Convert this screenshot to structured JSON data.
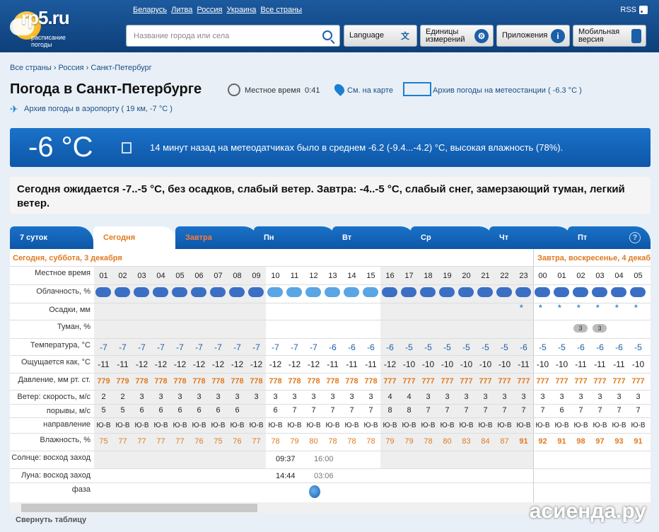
{
  "header": {
    "brand": "rp5.ru",
    "sub1": "расписание",
    "sub2": "погоды",
    "links": [
      "Беларусь",
      "Литва",
      "Россия",
      "Украина",
      "Все страны"
    ],
    "rss": "RSS",
    "search_placeholder": "Название города или села",
    "language": "Language",
    "units1": "Единицы",
    "units2": "измерений",
    "apps": "Приложения",
    "mobile1": "Мобильная",
    "mobile2": "версия"
  },
  "breadcrumb": [
    "Все страны",
    "Россия",
    "Санкт-Петербург"
  ],
  "title": "Погода в Санкт-Петербурге",
  "local_time_label": "Местное время",
  "local_time": "0:41",
  "map_link": "См. на карте",
  "archive_link": "Архив погоды на метеостанции ( -6.3 °C )",
  "airport_link": "Архив погоды в аэропорту ( 19 км, -7 °C )",
  "current": {
    "temp": "-6 °C",
    "text": "14 минут назад на метеодатчиках было в среднем -6.2 (-9.4...-4.2) °C, высокая влажность (78%)."
  },
  "summary": "Сегодня ожидается -7..-5 °C, без осадков, слабый ветер. Завтра: -4..-5 °C, слабый снег, замерзающий туман, легкий ветер.",
  "tabs": [
    "7 суток",
    "Сегодня",
    "Завтра",
    "Пн",
    "Вт",
    "Ср",
    "Чт",
    "Пт"
  ],
  "help": "?",
  "day1": "Сегодня, суббота, 3 декабря",
  "day2": "Завтра, воскресенье, 4 декабря",
  "rows": {
    "hours": "Местное время",
    "cloud": "Облачность, %",
    "precip": "Осадки, мм",
    "fog": "Туман, %",
    "temp": "Температура, °C",
    "feels": "Ощущается как, °C",
    "pressure": "Давление, мм рт. ст.",
    "windspeed": "Ветер: скорость, м/с",
    "gusts": "порывы, м/с",
    "dir": "направление",
    "humidity": "Влажность, %",
    "sun": "Солнце: восход заход",
    "moon": "Луна: восход заход",
    "phase": "фаза"
  },
  "hours": [
    "01",
    "02",
    "03",
    "04",
    "05",
    "06",
    "07",
    "08",
    "09",
    "10",
    "11",
    "12",
    "13",
    "14",
    "15",
    "16",
    "17",
    "18",
    "19",
    "20",
    "21",
    "22",
    "23",
    "00",
    "01",
    "02",
    "03",
    "04",
    "05"
  ],
  "temp": [
    "-7",
    "-7",
    "-7",
    "-7",
    "-7",
    "-7",
    "-7",
    "-7",
    "-7",
    "-7",
    "-7",
    "-7",
    "-6",
    "-6",
    "-6",
    "-6",
    "-5",
    "-5",
    "-5",
    "-5",
    "-5",
    "-5",
    "-6",
    "-5",
    "-5",
    "-6",
    "-6",
    "-6",
    "-5"
  ],
  "feels": [
    "-11",
    "-11",
    "-12",
    "-12",
    "-12",
    "-12",
    "-12",
    "-12",
    "-12",
    "-12",
    "-12",
    "-12",
    "-11",
    "-11",
    "-11",
    "-12",
    "-10",
    "-10",
    "-10",
    "-10",
    "-10",
    "-10",
    "-11",
    "-10",
    "-10",
    "-11",
    "-11",
    "-11",
    "-10"
  ],
  "pressure": [
    "779",
    "779",
    "778",
    "778",
    "778",
    "778",
    "778",
    "778",
    "778",
    "778",
    "778",
    "778",
    "778",
    "778",
    "778",
    "777",
    "777",
    "777",
    "777",
    "777",
    "777",
    "777",
    "777",
    "777",
    "777",
    "777",
    "777",
    "777",
    "777"
  ],
  "windspeed": [
    "2",
    "2",
    "3",
    "3",
    "3",
    "3",
    "3",
    "3",
    "3",
    "3",
    "3",
    "3",
    "3",
    "3",
    "3",
    "4",
    "4",
    "3",
    "3",
    "3",
    "3",
    "3",
    "3",
    "3",
    "3",
    "3",
    "3",
    "3",
    "3"
  ],
  "gusts": [
    "5",
    "5",
    "6",
    "6",
    "6",
    "6",
    "6",
    "6",
    "6",
    "6",
    "7",
    "7",
    "7",
    "7",
    "7",
    "8",
    "8",
    "7",
    "7",
    "7",
    "7",
    "7",
    "7",
    "7",
    "6",
    "7",
    "7",
    "7",
    "7"
  ],
  "dir": "Ю-В",
  "humidity": [
    "75",
    "77",
    "77",
    "77",
    "77",
    "76",
    "75",
    "76",
    "77",
    "78",
    "79",
    "80",
    "78",
    "78",
    "78",
    "79",
    "79",
    "78",
    "80",
    "83",
    "84",
    "87",
    "91",
    "92",
    "91",
    "98",
    "97",
    "93",
    "91"
  ],
  "snow_cols": [
    22,
    23,
    24,
    25,
    26,
    27,
    28
  ],
  "fog_val": "3",
  "sunrise": "09:37",
  "sunset": "16:00",
  "moonrise": "14:44",
  "moonset": "03:06",
  "collapse": "Свернуть таблицу",
  "watermark": "асиенда.ру",
  "colors": {
    "header": "#1c5a9e",
    "accent": "#e07a1f",
    "humidity": "#e07a1f",
    "pressure": "#e07a1f",
    "temp": "#1b5fa8"
  }
}
